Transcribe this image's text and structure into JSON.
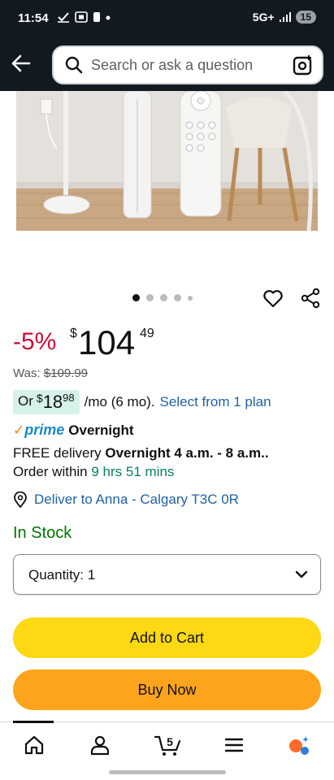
{
  "status_bar": {
    "time": "11:54",
    "network": "5G+",
    "battery": "15"
  },
  "header": {
    "search_placeholder": "Search or ask a question",
    "icons": [
      "back-arrow-icon",
      "search-icon",
      "camera-lens-icon"
    ]
  },
  "gallery": {
    "image_count": 5,
    "active_index": 0
  },
  "product": {
    "discount": "-5%",
    "price_currency": "$",
    "price_whole": "104",
    "price_fraction": "49",
    "was_label": "Was:",
    "was_price": "$109.99",
    "monthly": {
      "prefix": "Or",
      "currency": "$",
      "whole": "18",
      "fraction": "98",
      "term": "/mo (6 mo).",
      "link": "Select from 1 plan"
    },
    "prime_brand": "prime",
    "prime_speed": "Overnight",
    "delivery_free": "FREE delivery",
    "delivery_window": "Overnight 4 a.m. - 8 a.m.",
    "delivery_suffix": ".",
    "order_within_label": "Order within",
    "order_within_time": "9 hrs 51 mins",
    "deliver_to": "Deliver to Anna - Calgary T3C 0R",
    "stock": "In Stock",
    "quantity_label": "Quantity: 1"
  },
  "buttons": {
    "add_to_cart": "Add to Cart",
    "buy_now": "Buy Now"
  },
  "nav": {
    "cart_count": "5",
    "items": [
      "home-icon",
      "account-icon",
      "cart-icon",
      "menu-icon",
      "rufus-icon"
    ]
  },
  "colors": {
    "header_bg": "#131921",
    "discount": "#cc0c39",
    "link": "#2162a1",
    "in_stock": "#007600",
    "add_to_cart": "#ffd814",
    "buy_now": "#ffa41c",
    "monthly_badge": "#d7f2e8"
  }
}
